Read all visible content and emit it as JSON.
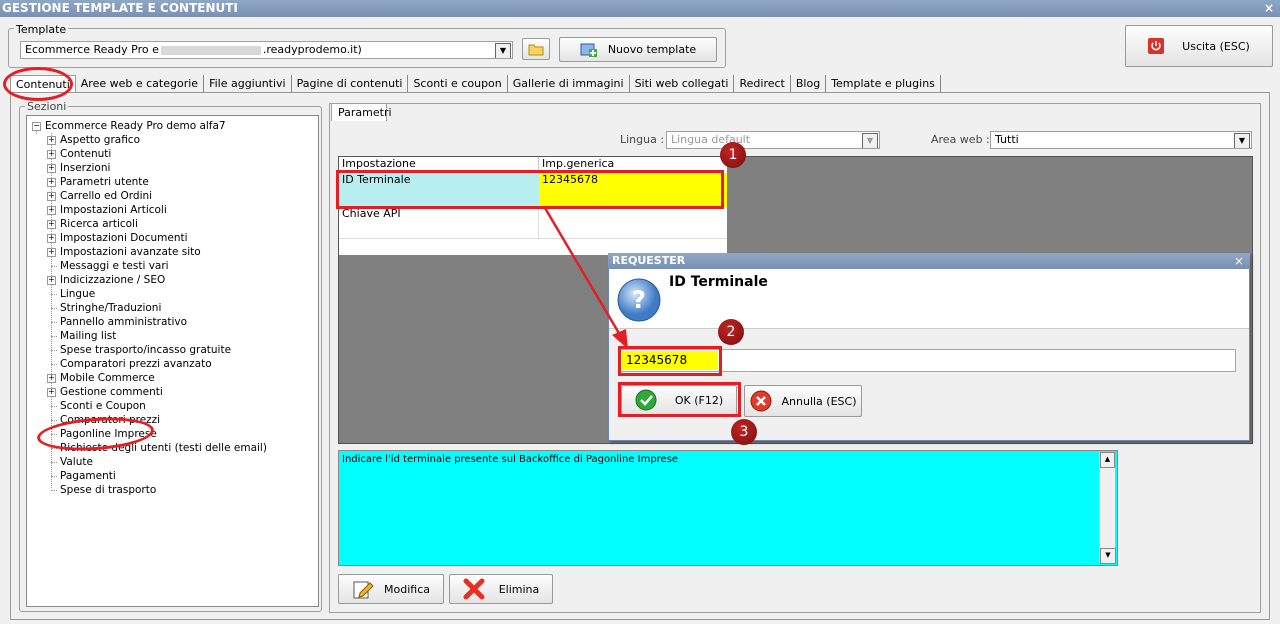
{
  "window": {
    "title": "GESTIONE TEMPLATE E CONTENUTI",
    "close_glyph": "×"
  },
  "template": {
    "label": "Template",
    "selected_value": "Ecommerce Ready Pro e",
    "selected_value_suffix": ".readyprodemo.it)",
    "new_template_label": "Nuovo template"
  },
  "exit_button": {
    "label": "Uscita (ESC)"
  },
  "tabs": [
    {
      "label": "Contenuti"
    },
    {
      "label": "Aree web e categorie"
    },
    {
      "label": "File aggiuntivi"
    },
    {
      "label": "Pagine di contenuti"
    },
    {
      "label": "Sconti e coupon"
    },
    {
      "label": "Gallerie di immagini"
    },
    {
      "label": "Siti web collegati"
    },
    {
      "label": "Redirect"
    },
    {
      "label": "Blog"
    },
    {
      "label": "Template e plugins"
    }
  ],
  "sections": {
    "label": "Sezioni",
    "root": "Ecommerce Ready Pro demo alfa7",
    "items": [
      {
        "label": "Aspetto grafico",
        "expandable": true
      },
      {
        "label": "Contenuti",
        "expandable": true
      },
      {
        "label": "Inserzioni",
        "expandable": true
      },
      {
        "label": "Parametri utente",
        "expandable": true
      },
      {
        "label": "Carrello ed Ordini",
        "expandable": true
      },
      {
        "label": "Impostazioni Articoli",
        "expandable": true
      },
      {
        "label": "Ricerca articoli",
        "expandable": true
      },
      {
        "label": "Impostazioni Documenti",
        "expandable": true
      },
      {
        "label": "Impostazioni avanzate sito",
        "expandable": true
      },
      {
        "label": "Messaggi e testi vari",
        "expandable": false
      },
      {
        "label": "Indicizzazione / SEO",
        "expandable": true
      },
      {
        "label": "Lingue",
        "expandable": false
      },
      {
        "label": "Stringhe/Traduzioni",
        "expandable": false
      },
      {
        "label": "Pannello amministrativo",
        "expandable": false
      },
      {
        "label": "Mailing list",
        "expandable": false
      },
      {
        "label": "Spese trasporto/incasso gratuite",
        "expandable": false
      },
      {
        "label": "Comparatori prezzi avanzato",
        "expandable": false
      },
      {
        "label": "Mobile Commerce",
        "expandable": true
      },
      {
        "label": "Gestione commenti",
        "expandable": true
      },
      {
        "label": "Sconti e Coupon",
        "expandable": false
      },
      {
        "label": "Comparatori prezzi",
        "expandable": false
      },
      {
        "label": "Pagonline Imprese",
        "expandable": false,
        "selected": true
      },
      {
        "label": "Richieste degli utenti (testi delle email)",
        "expandable": false
      },
      {
        "label": "Valute",
        "expandable": false
      },
      {
        "label": "Pagamenti",
        "expandable": false
      },
      {
        "label": "Spese di trasporto",
        "expandable": false
      }
    ]
  },
  "params": {
    "tab_label": "Parametri",
    "lingua_label": "Lingua :",
    "lingua_value": "Lingua default",
    "area_web_label": "Area web :",
    "area_web_value": "Tutti",
    "grid": {
      "headers": [
        "Impostazione",
        "Imp.generica"
      ],
      "rows": [
        {
          "setting": "ID Terminale",
          "value": "12345678"
        },
        {
          "setting": "Chiave API",
          "value": ""
        }
      ]
    },
    "description": "Indicare l'id terminale presente sul Backoffice di Pagonline Imprese",
    "modify_label": "Modifica",
    "delete_label": "Elimina"
  },
  "dialog": {
    "title": "REQUESTER",
    "close_glyph": "×",
    "heading": "ID Terminale",
    "input_value": "12345678",
    "ok_label": "OK (F12)",
    "cancel_label": "Annulla (ESC)"
  },
  "annotations": [
    {
      "label": "1"
    },
    {
      "label": "2"
    },
    {
      "label": "3"
    }
  ],
  "colors": {
    "title_bar": "#8097b8",
    "highlight_yellow": "#ffff00",
    "row_cyan": "#b7eff1",
    "description_bg": "#00ffff",
    "annotation_red": "#e31e24",
    "grid_gray": "#808080"
  }
}
